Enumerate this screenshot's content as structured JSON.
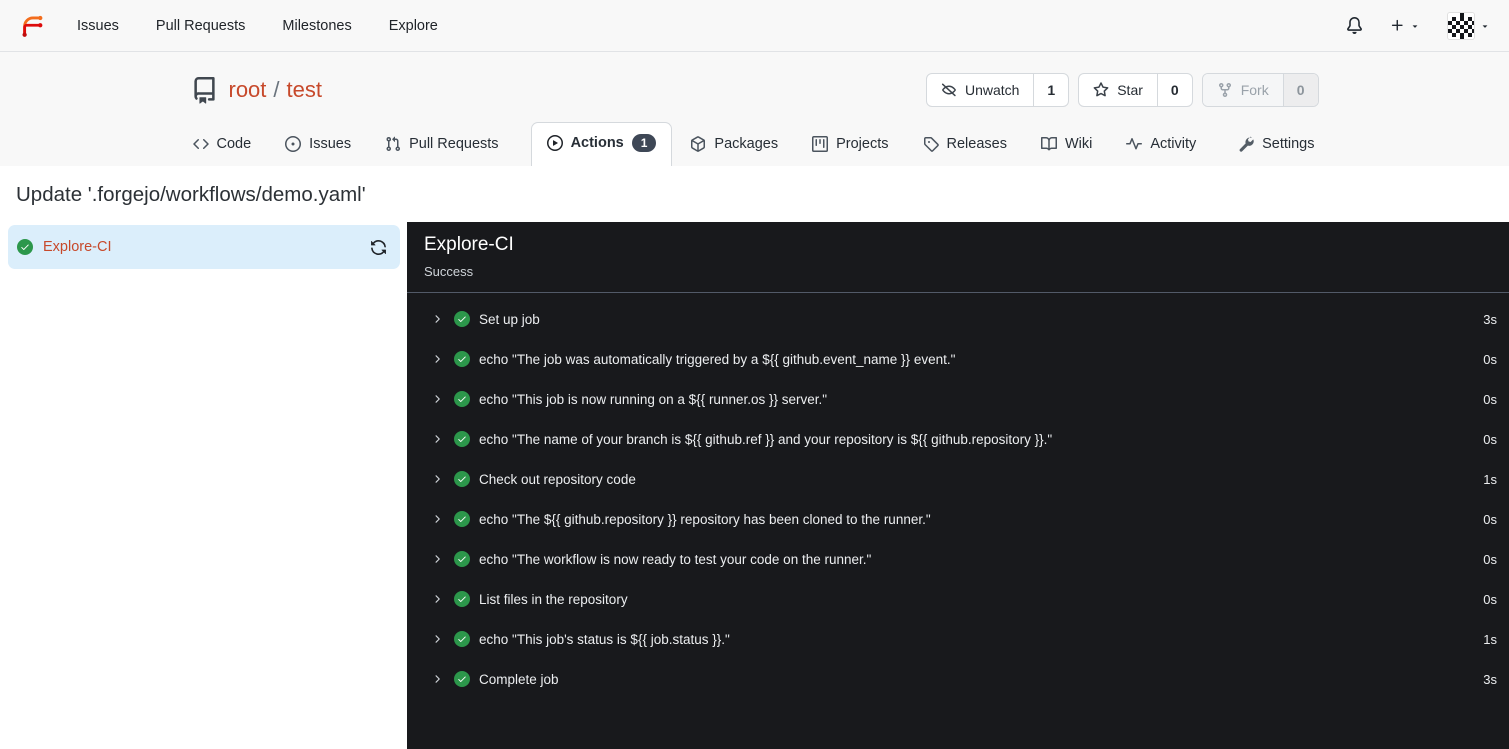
{
  "colors": {
    "accent_link": "#c7492b",
    "success_green": "#2c974b",
    "panel_bg": "#18191c",
    "panel_divider": "#525a68",
    "sidebar_selected_bg": "#dbeefb",
    "badge_bg": "#3e4756"
  },
  "navbar": {
    "links": [
      {
        "label": "Issues"
      },
      {
        "label": "Pull Requests"
      },
      {
        "label": "Milestones"
      },
      {
        "label": "Explore"
      }
    ],
    "icons": [
      "forgejo-logo",
      "bell-icon",
      "plus-icon",
      "avatar-identicon"
    ]
  },
  "repo_header": {
    "owner": "root",
    "separator": "/",
    "name": "test",
    "buttons": [
      {
        "label": "Unwatch",
        "count": "1"
      },
      {
        "label": "Star",
        "count": "0"
      },
      {
        "label": "Fork",
        "count": "0",
        "disabled": true
      }
    ]
  },
  "tabs": [
    {
      "label": "Code"
    },
    {
      "label": "Issues"
    },
    {
      "label": "Pull Requests"
    },
    {
      "label": "Actions",
      "badge": "1",
      "active": true
    },
    {
      "label": "Packages"
    },
    {
      "label": "Projects"
    },
    {
      "label": "Releases"
    },
    {
      "label": "Wiki"
    },
    {
      "label": "Activity"
    },
    {
      "label": "Settings"
    }
  ],
  "run": {
    "title": "Update '.forgejo/workflows/demo.yaml'",
    "job_list": [
      {
        "name": "Explore-CI",
        "status": "success"
      }
    ],
    "detail": {
      "title": "Explore-CI",
      "status": "Success"
    },
    "steps": [
      {
        "name": "Set up job",
        "duration": "3s"
      },
      {
        "name": "echo \"The job was automatically triggered by a ${{ github.event_name }} event.\"",
        "duration": "0s"
      },
      {
        "name": "echo \"This job is now running on a ${{ runner.os }} server.\"",
        "duration": "0s"
      },
      {
        "name": "echo \"The name of your branch is ${{ github.ref }} and your repository is ${{ github.repository }}.\"",
        "duration": "0s"
      },
      {
        "name": "Check out repository code",
        "duration": "1s"
      },
      {
        "name": "echo \"The ${{ github.repository }} repository has been cloned to the runner.\"",
        "duration": "0s"
      },
      {
        "name": "echo \"The workflow is now ready to test your code on the runner.\"",
        "duration": "0s"
      },
      {
        "name": "List files in the repository",
        "duration": "0s"
      },
      {
        "name": "echo \"This job's status is ${{ job.status }}.\"",
        "duration": "1s"
      },
      {
        "name": "Complete job",
        "duration": "3s"
      }
    ]
  }
}
